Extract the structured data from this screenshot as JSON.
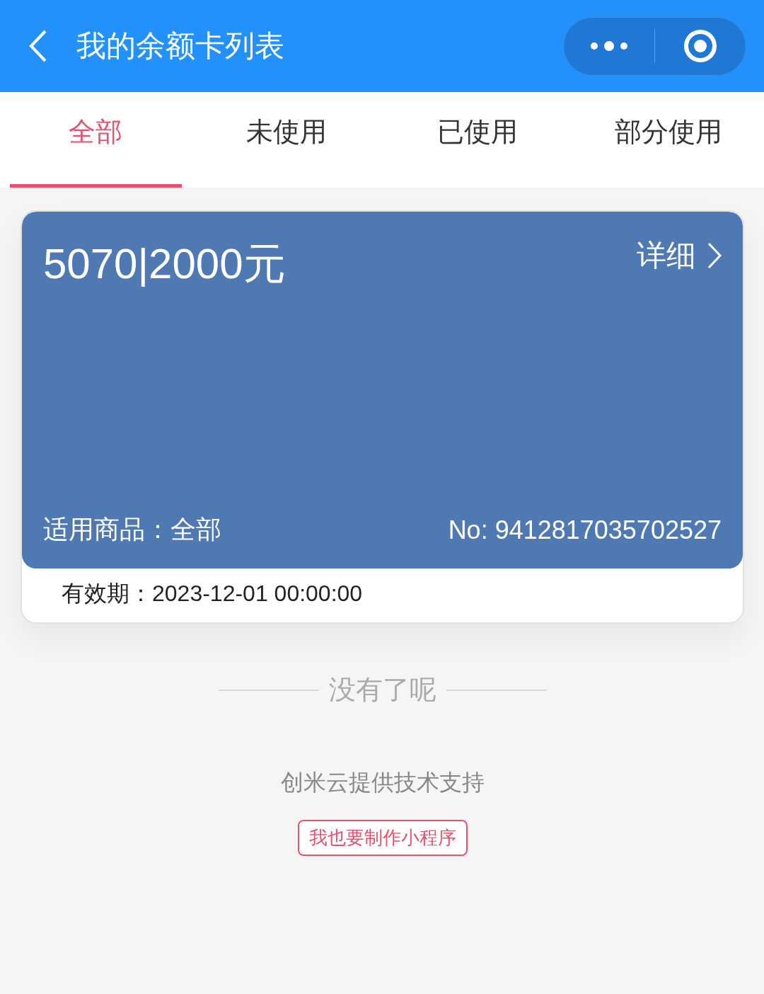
{
  "header": {
    "title": "我的余额卡列表"
  },
  "tabs": [
    {
      "label": "全部",
      "selected": true
    },
    {
      "label": "未使用",
      "selected": false
    },
    {
      "label": "已使用",
      "selected": false
    },
    {
      "label": "部分使用",
      "selected": false
    }
  ],
  "cards": [
    {
      "title": "5070|2000元",
      "detail": "详细",
      "goods": "适用商品：全部",
      "number": "No: 9412817035702527",
      "validity": "有效期：2023-12-01 00:00:00"
    }
  ],
  "end_note": "没有了呢",
  "footer": {
    "support": "创米云提供技术支持",
    "button": "我也要制作小程序"
  }
}
